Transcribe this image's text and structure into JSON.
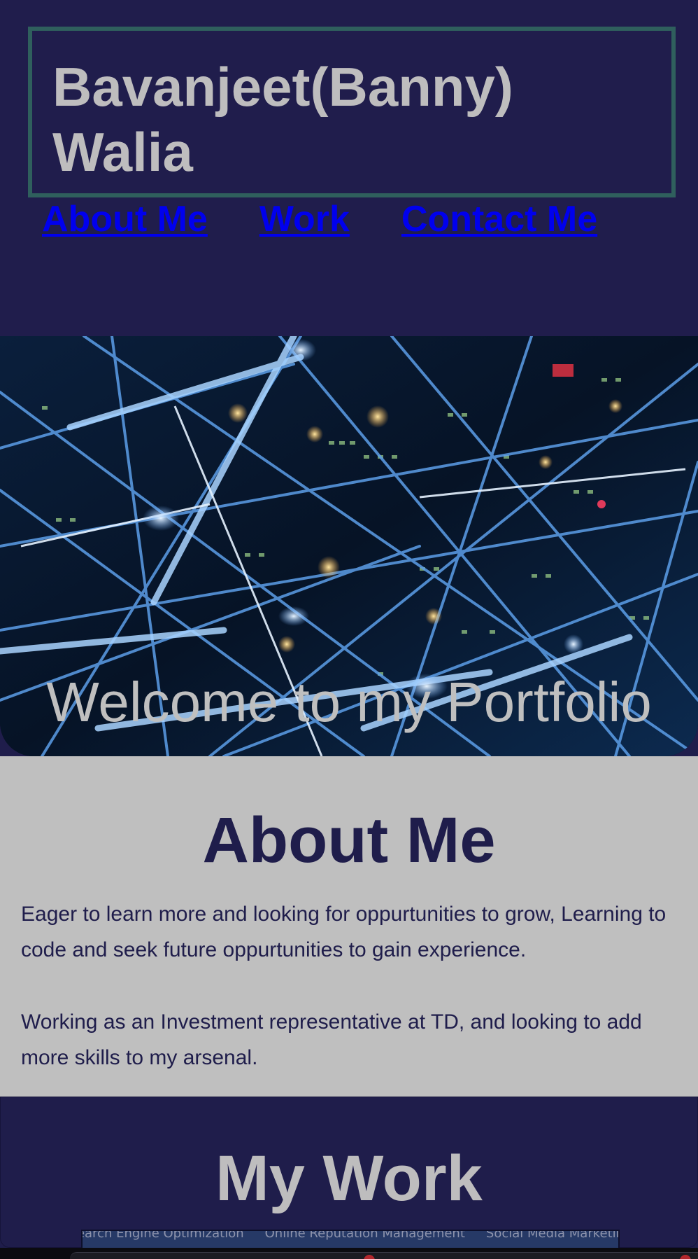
{
  "header": {
    "title_line1": "Bavanjeet(Banny)",
    "title_line2": "Walia",
    "nav": [
      {
        "label": "About Me"
      },
      {
        "label": "Work"
      },
      {
        "label": "Contact Me"
      }
    ]
  },
  "hero": {
    "welcome_text": "Welcome to my Portfolio"
  },
  "about": {
    "heading": "About Me",
    "paragraph1": "Eager to learn more and looking for oppurtunities to grow, Learning to code and seek future oppurtunities to gain experience.",
    "paragraph2": "Working as an Investment representative at TD, and looking to add more skills to my arsenal."
  },
  "work": {
    "heading": "My Work",
    "services": [
      "Search Engine Optimization",
      "Online Reputation Management",
      "Social Media Marketing"
    ]
  },
  "colors": {
    "background_navy": "#1f1d4b",
    "title_border": "#2f5f5d",
    "title_text": "#bebdbe",
    "link": "#0000ee",
    "about_background": "#bfbfbf"
  }
}
